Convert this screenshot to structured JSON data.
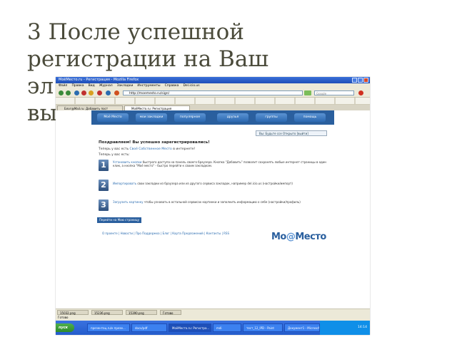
{
  "slide": {
    "title_line1": "3 После успешной",
    "title_line2": "регистрации на Ваш",
    "title_line3": "эл",
    "title_line4": "вы"
  },
  "browser": {
    "window_title": "МоёМесто.ru - Регистрация - Mozilla Firefox",
    "menu": [
      "Файл",
      "Правка",
      "Вид",
      "Журнал",
      "Закладки",
      "Инструменты",
      "Справка",
      "Del.icio.us"
    ],
    "address": "http://moemesto.ru/sign/",
    "search_placeholder": "Google",
    "tabs": [
      "Блог@Mail.ru: Добавить пост",
      "МоёМесто.ru: Регистрация"
    ]
  },
  "site": {
    "nav": [
      "Моё Место",
      "мои закладки",
      "популярное",
      "друзья",
      "группы",
      "помощь"
    ],
    "user_bar": "Вы: Будьте ссе  Открыто  [выйти]",
    "congrats": "Поздравляем! Вы успешно зарегистрировались!",
    "have_place_prefix": "Теперь у вас есть",
    "have_place_link": "Своё Собственное Место",
    "have_place_suffix": "в интернете!",
    "can_do": "Теперь у вас есть:",
    "steps": [
      {
        "num": "1",
        "link": "Установить кнопки",
        "text": "быстрого доступа на панель своего браузера. Кнопка \"Добавить\" позволит сохранять любые интернет страницы в один клик, а кнопка \"Моё место\" - быстро перейти к своим закладкам."
      },
      {
        "num": "2",
        "link": "Импортировать",
        "text": "свои закладки из браузера или из другого сервиса закладок, например del.icio.us (настройки/импорт)"
      },
      {
        "num": "3",
        "link": "Загрузить картинку",
        "text": "чтобы узнавать в остальной сервисах картинки и заполнить информацию о себе (настройки/профиль)"
      }
    ],
    "back_button": "Перейти на Мою страницу",
    "footer": "О проекте  |  Новости  |  Про Поддержка  |  Блог  |  Карта Предложений  |  Контакты  |  RSS",
    "logo_part1": "Мо",
    "logo_part2": "@",
    "logo_part3": "Место"
  },
  "downloads": [
    "15032.png",
    "15236.png",
    "15390.png",
    "Готово"
  ],
  "status": "Готово",
  "taskbar": {
    "start": "пуск",
    "tasks": [
      "презентац.ru/к презе...",
      "docx/pdf",
      "МоёМесто.ru: Регистра...",
      "mdi",
      "тест_12_IPD - Paint",
      "Документ1 - Microsoft..."
    ],
    "clock": "14:14"
  },
  "colors": {
    "site_blue": "#2a5f9e",
    "link_blue": "#2b6cb0",
    "title_text": "#4a4a3a"
  }
}
